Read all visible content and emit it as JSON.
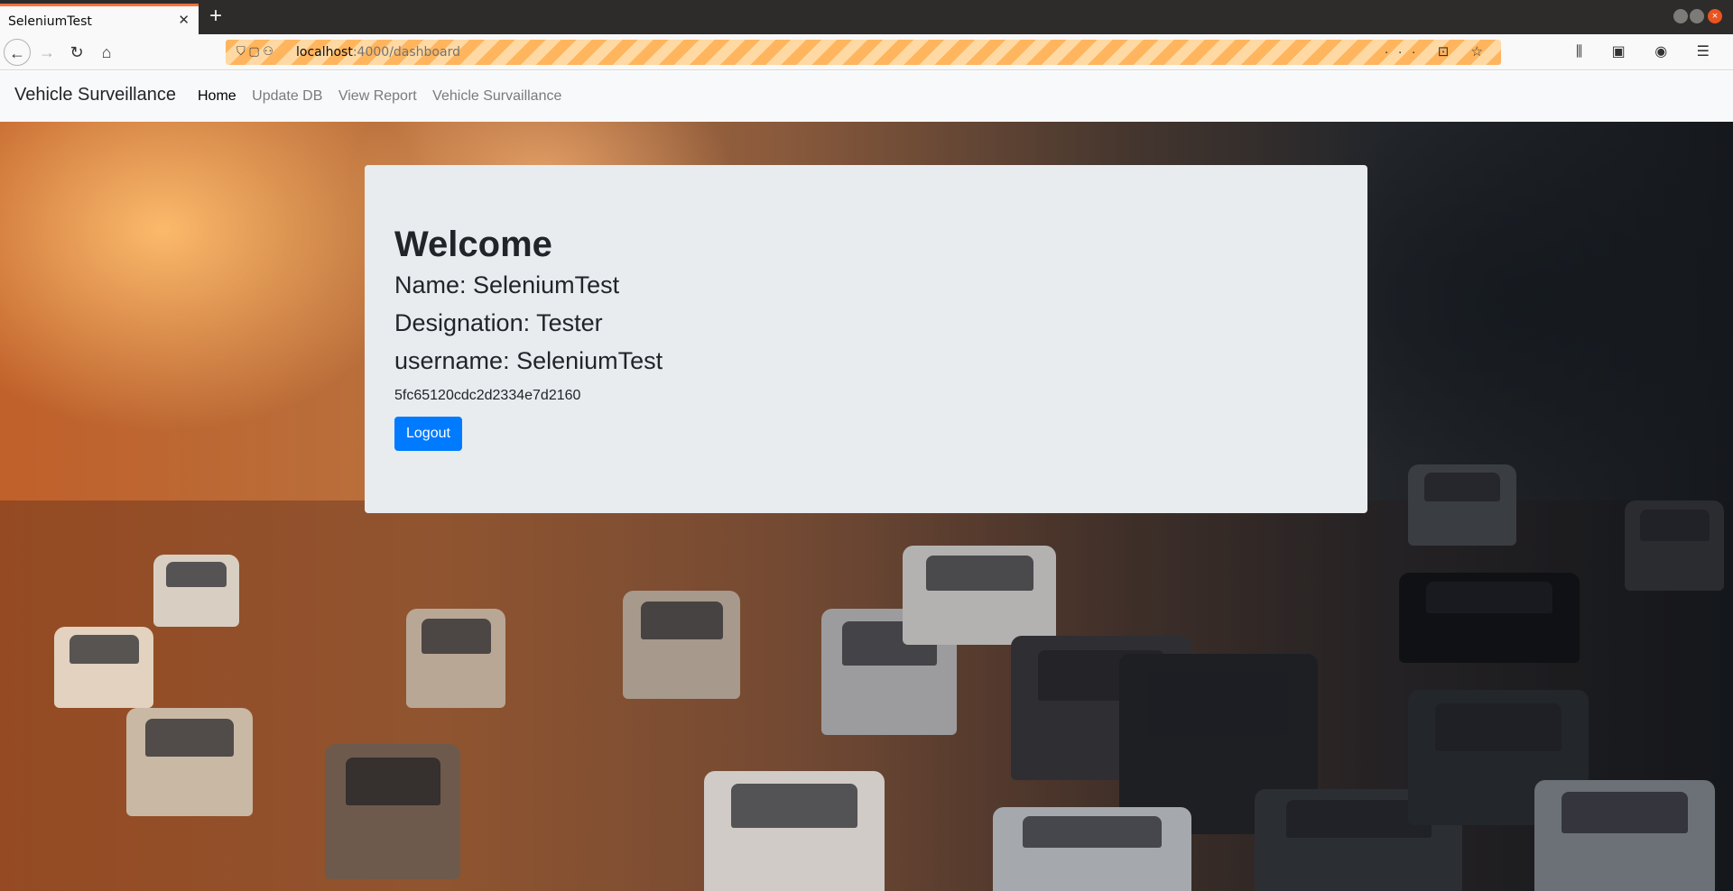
{
  "browser": {
    "tab_title": "SeleniumTest",
    "tab_close": "✕",
    "new_tab": "+",
    "url_host": "localhost",
    "url_path": ":4000/dashboard",
    "url_actions": "··· ⊡ ☆",
    "toolbar_right": "⫼ ▣ ◉ ☰"
  },
  "navbar": {
    "brand": "Vehicle Surveillance",
    "links": [
      {
        "label": "Home",
        "active": true
      },
      {
        "label": "Update DB",
        "active": false
      },
      {
        "label": "View Report",
        "active": false
      },
      {
        "label": "Vehicle Survaillance",
        "active": false
      }
    ]
  },
  "dashboard": {
    "welcome": "Welcome",
    "name_line": "Name: SeleniumTest",
    "designation_line": "Designation: Tester",
    "username_line": "username: SeleniumTest",
    "user_id": "5fc65120cdc2d2334e7d2160",
    "logout_label": "Logout"
  },
  "colors": {
    "primary_button": "#007bff",
    "jumbotron_bg": "#e9ecef",
    "navbar_bg": "#f8f9fa"
  }
}
